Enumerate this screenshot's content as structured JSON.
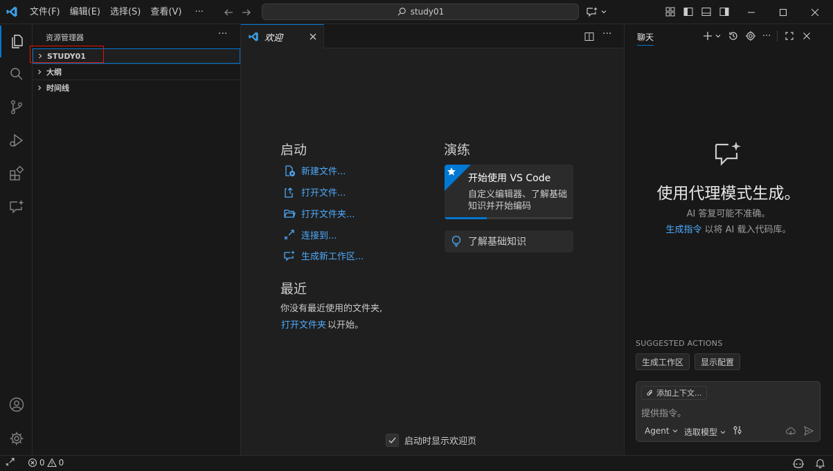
{
  "titlebar": {
    "menus": [
      "文件(F)",
      "编辑(E)",
      "选择(S)",
      "查看(V)"
    ],
    "more": "···",
    "search_text": "study01"
  },
  "sidebar": {
    "title": "资源管理器",
    "more": "···",
    "items": [
      {
        "label": "STUDY01"
      },
      {
        "label": "大纲"
      },
      {
        "label": "时间线"
      }
    ]
  },
  "editor": {
    "tab_label": "欢迎",
    "start": {
      "heading": "启动",
      "actions": [
        "新建文件...",
        "打开文件...",
        "打开文件夹...",
        "连接到...",
        "生成新工作区..."
      ]
    },
    "recent": {
      "heading": "最近",
      "empty_text": "你没有最近使用的文件夹,",
      "open_folder_link": "打开文件夹",
      "suffix": "以开始。"
    },
    "walkthroughs": {
      "heading": "演练",
      "card_title": "开始使用 VS Code",
      "card_desc_line1": "自定义编辑器、了解基础",
      "card_desc_line2": "知识并开始编码",
      "progress": 0.33,
      "learn_label": "了解基础知识"
    },
    "show_on_startup": "启动时显示欢迎页"
  },
  "chat": {
    "tab_label": "聊天",
    "headline": "使用代理模式生成。",
    "disclaimer": "AI 答复可能不准确。",
    "generate_link": "生成指令",
    "generate_suffix": "以将 AI 载入代码库。",
    "suggested_title": "SUGGESTED ACTIONS",
    "suggested": [
      "生成工作区",
      "显示配置"
    ],
    "add_context": "添加上下文...",
    "input_placeholder": "提供指令。",
    "agent_label": "Agent",
    "model_label": "选取模型"
  },
  "statusbar": {
    "errors": "0",
    "warnings": "0"
  },
  "colors": {
    "accent": "#0078d4",
    "link": "#4daafc",
    "highlight_box": "#e51400"
  }
}
